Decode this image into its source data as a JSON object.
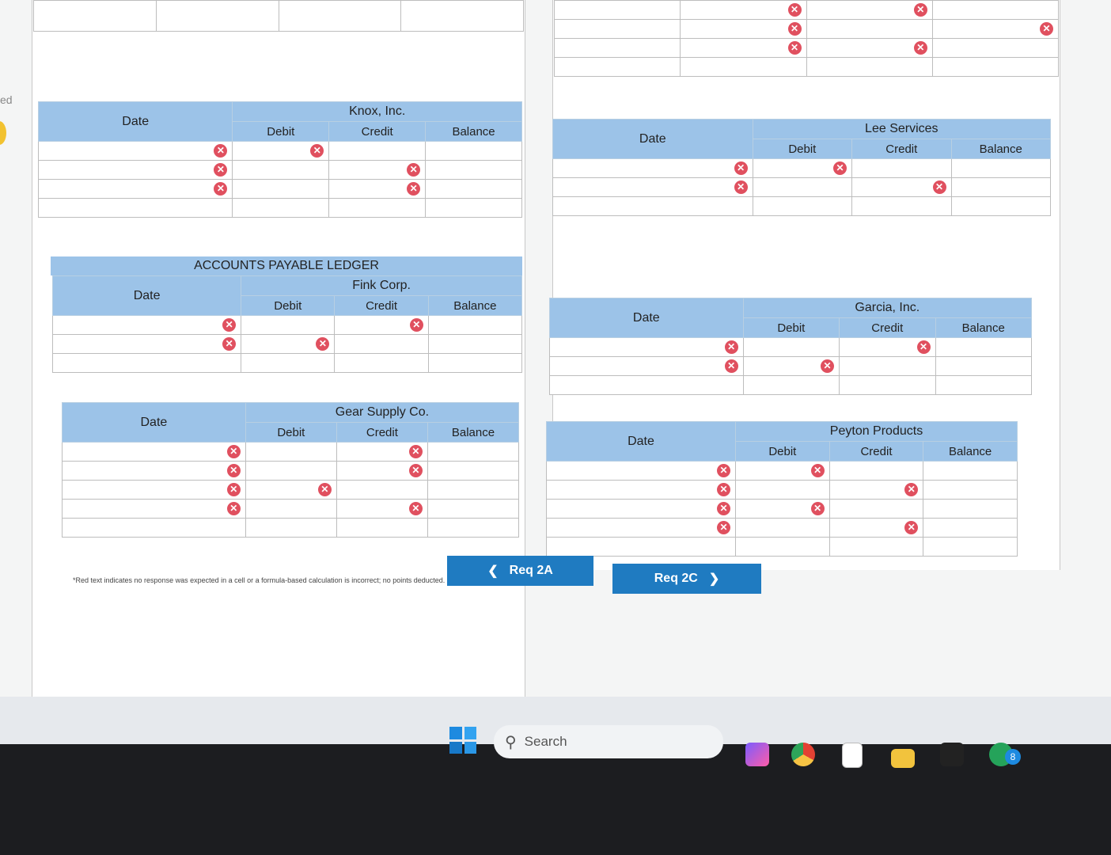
{
  "columns": {
    "date": "Date",
    "debit": "Debit",
    "credit": "Credit",
    "balance": "Balance"
  },
  "left_edge_text": "ed",
  "section_title": "ACCOUNTS PAYABLE LEDGER",
  "ledgers": [
    {
      "id": "knox",
      "name": "Knox, Inc.",
      "rows": [
        [
          "x",
          "x",
          "",
          ""
        ],
        [
          "x",
          "",
          "x",
          ""
        ],
        [
          "x",
          "",
          "x",
          ""
        ],
        [
          "",
          "",
          "",
          ""
        ]
      ]
    },
    {
      "id": "lee",
      "name": "Lee Services",
      "rows": [
        [
          "x",
          "x",
          "",
          ""
        ],
        [
          "x",
          "",
          "x",
          ""
        ],
        [
          "",
          "",
          "",
          ""
        ]
      ]
    },
    {
      "id": "fink",
      "name": "Fink Corp.",
      "rows": [
        [
          "x",
          "",
          "x",
          ""
        ],
        [
          "x",
          "x",
          "",
          ""
        ],
        [
          "",
          "",
          "",
          ""
        ]
      ]
    },
    {
      "id": "garcia",
      "name": "Garcia, Inc.",
      "rows": [
        [
          "x",
          "",
          "x",
          ""
        ],
        [
          "x",
          "x",
          "",
          ""
        ],
        [
          "",
          "",
          "",
          ""
        ]
      ]
    },
    {
      "id": "gear",
      "name": "Gear Supply Co.",
      "rows": [
        [
          "x",
          "",
          "x",
          ""
        ],
        [
          "x",
          "",
          "x",
          ""
        ],
        [
          "x",
          "x",
          "",
          ""
        ],
        [
          "x",
          "",
          "x",
          ""
        ],
        [
          "",
          "",
          "",
          ""
        ]
      ]
    },
    {
      "id": "peyton",
      "name": "Peyton Products",
      "rows": [
        [
          "x",
          "x",
          "",
          ""
        ],
        [
          "x",
          "",
          "x",
          ""
        ],
        [
          "x",
          "x",
          "",
          ""
        ],
        [
          "x",
          "",
          "x",
          ""
        ],
        [
          "",
          "",
          "",
          ""
        ]
      ]
    }
  ],
  "nav": {
    "prev": "Req 2A",
    "next": "Req 2C"
  },
  "footnote": "*Red text indicates no response was expected in a cell or a formula-based calculation is incorrect; no points deducted.",
  "taskbar": {
    "search_placeholder": "Search",
    "notification_count": "8"
  }
}
